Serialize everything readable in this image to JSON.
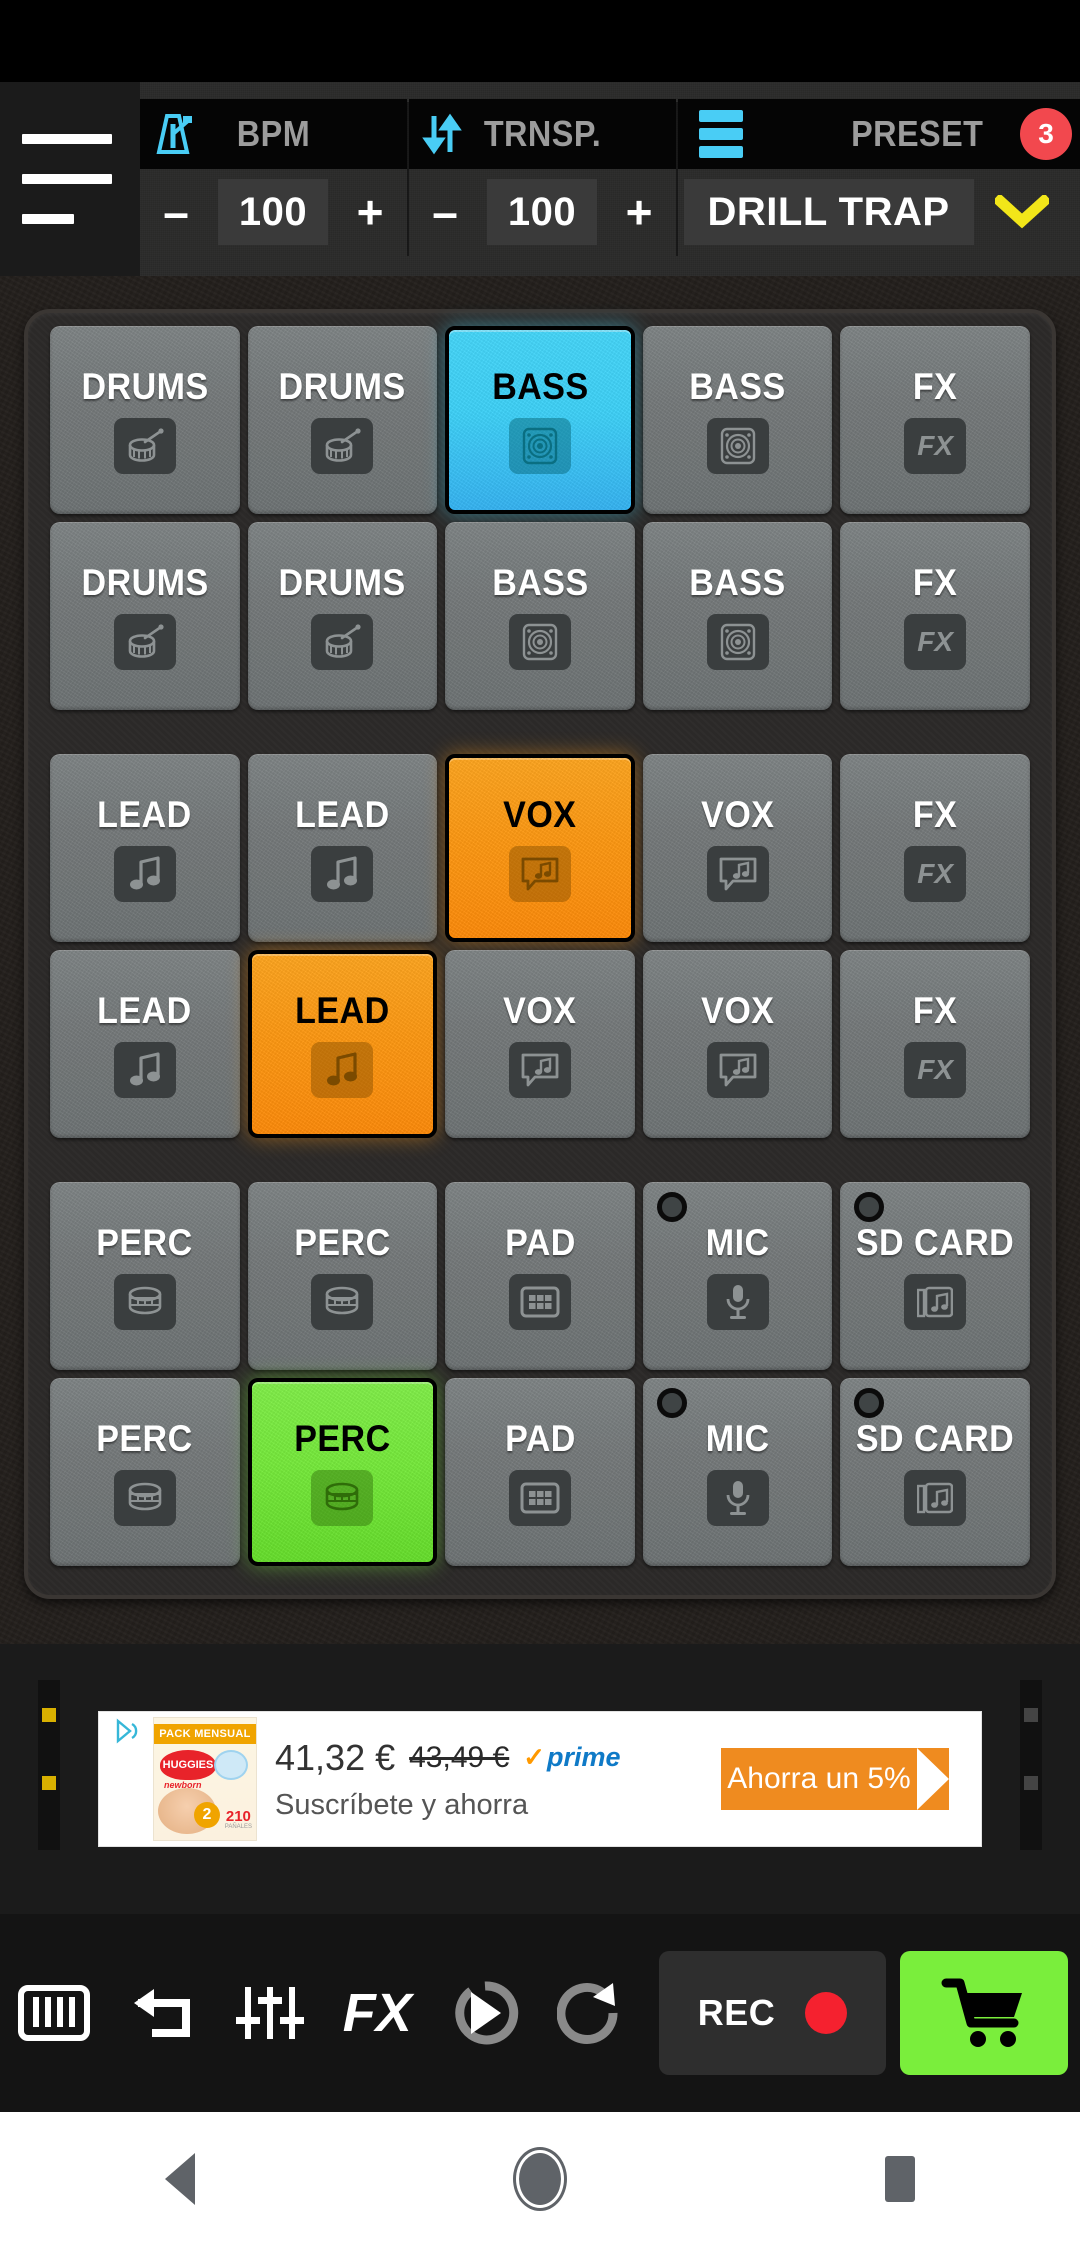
{
  "topbar": {
    "menu_icon": "hamburger-menu-icon",
    "bpm": {
      "icon": "metronome-icon",
      "label": "BPM",
      "minus": "–",
      "value": "100",
      "plus": "+"
    },
    "transpose": {
      "icon": "transpose-arrows-icon",
      "label": "TRNSP.",
      "minus": "–",
      "value": "100",
      "plus": "+"
    },
    "preset": {
      "icon": "preset-list-icon",
      "label": "PRESET",
      "badge": "3",
      "name": "DRILL TRAP",
      "caret_icon": "chevron-down-icon"
    }
  },
  "pads": {
    "groups": [
      {
        "rows": [
          [
            {
              "label": "DRUMS",
              "icon": "snare-drum-icon",
              "state": "idle"
            },
            {
              "label": "DRUMS",
              "icon": "snare-drum-icon",
              "state": "idle"
            },
            {
              "label": "BASS",
              "icon": "speaker-icon",
              "state": "cyan"
            },
            {
              "label": "BASS",
              "icon": "speaker-icon",
              "state": "idle"
            },
            {
              "label": "FX",
              "icon": "fx-icon",
              "state": "idle"
            }
          ],
          [
            {
              "label": "DRUMS",
              "icon": "snare-drum-icon",
              "state": "idle"
            },
            {
              "label": "DRUMS",
              "icon": "snare-drum-icon",
              "state": "idle"
            },
            {
              "label": "BASS",
              "icon": "speaker-icon",
              "state": "idle"
            },
            {
              "label": "BASS",
              "icon": "speaker-icon",
              "state": "idle"
            },
            {
              "label": "FX",
              "icon": "fx-icon",
              "state": "idle"
            }
          ]
        ]
      },
      {
        "rows": [
          [
            {
              "label": "LEAD",
              "icon": "music-note-icon",
              "state": "idle"
            },
            {
              "label": "LEAD",
              "icon": "music-note-icon",
              "state": "idle"
            },
            {
              "label": "VOX",
              "icon": "vocal-bubble-icon",
              "state": "orange"
            },
            {
              "label": "VOX",
              "icon": "vocal-bubble-icon",
              "state": "idle"
            },
            {
              "label": "FX",
              "icon": "fx-icon",
              "state": "idle"
            }
          ],
          [
            {
              "label": "LEAD",
              "icon": "music-note-icon",
              "state": "idle"
            },
            {
              "label": "LEAD",
              "icon": "music-note-icon",
              "state": "orange"
            },
            {
              "label": "VOX",
              "icon": "vocal-bubble-icon",
              "state": "idle"
            },
            {
              "label": "VOX",
              "icon": "vocal-bubble-icon",
              "state": "idle"
            },
            {
              "label": "FX",
              "icon": "fx-icon",
              "state": "idle"
            }
          ]
        ]
      },
      {
        "rows": [
          [
            {
              "label": "PERC",
              "icon": "conga-drum-icon",
              "state": "idle"
            },
            {
              "label": "PERC",
              "icon": "conga-drum-icon",
              "state": "idle"
            },
            {
              "label": "PAD",
              "icon": "grid-pad-icon",
              "state": "idle"
            },
            {
              "label": "MIC",
              "icon": "microphone-icon",
              "state": "idle",
              "led": true
            },
            {
              "label": "SD CARD",
              "icon": "sd-music-icon",
              "state": "idle",
              "led": true
            }
          ],
          [
            {
              "label": "PERC",
              "icon": "conga-drum-icon",
              "state": "idle"
            },
            {
              "label": "PERC",
              "icon": "conga-drum-icon",
              "state": "green"
            },
            {
              "label": "PAD",
              "icon": "grid-pad-icon",
              "state": "idle"
            },
            {
              "label": "MIC",
              "icon": "microphone-icon",
              "state": "idle",
              "led": true
            },
            {
              "label": "SD CARD",
              "icon": "sd-music-icon",
              "state": "idle",
              "led": true
            }
          ]
        ]
      }
    ]
  },
  "ad": {
    "adchoices_icon": "adchoices-icon",
    "product": {
      "band": "PACK MENSUAL",
      "brand": "HUGGIES",
      "sub": "newborn",
      "size": "2",
      "count": "210",
      "count_unit": "PAÑALES"
    },
    "price": "41,32 €",
    "old_price": "43,49 €",
    "prime_check": "✓",
    "prime_word": "prime",
    "subtitle": "Suscríbete y ahorra",
    "cta": "Ahorra un 5%"
  },
  "toolbar": {
    "items": [
      {
        "name": "keyboard-icon",
        "type": "icon"
      },
      {
        "name": "undo-icon",
        "type": "icon"
      },
      {
        "name": "mixer-icon",
        "type": "icon"
      },
      {
        "name": "fx-icon",
        "type": "text",
        "text": "FX"
      },
      {
        "name": "play-loop-icon",
        "type": "icon"
      },
      {
        "name": "loop-icon",
        "type": "icon"
      }
    ],
    "rec_label": "REC",
    "rec_dot": "record-dot-icon",
    "cart_icon": "shopping-cart-icon"
  },
  "navbar": {
    "back": "back-nav-icon",
    "home": "home-nav-icon",
    "recents": "recents-nav-icon"
  },
  "colors": {
    "cyan": "#46d8fb",
    "orange": "#ff9a13",
    "green": "#77ec3c",
    "badge_red": "#f2484e",
    "accent_blue": "#49cdf5",
    "cta_orange": "#ef8b1f",
    "cart_green": "#7aee3c",
    "rec_red": "#f5212f"
  }
}
